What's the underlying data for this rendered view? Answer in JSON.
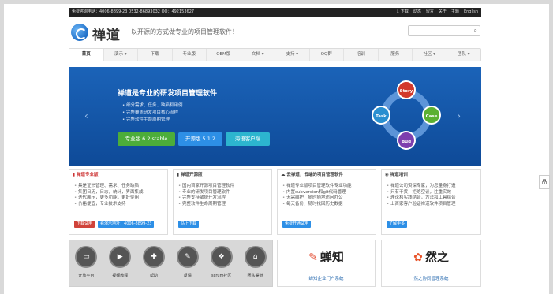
{
  "topbar": {
    "hotline": "免费咨询电话：4006-8899-23 0532-86893032 QQ：492153627",
    "links": [
      "⇩ 下载",
      "动态",
      "留言",
      "关于",
      "主题",
      "English"
    ]
  },
  "header": {
    "logo": "禅道",
    "slogan": "以开源的方式做专业的项目管理软件！",
    "search_icon": "⌕"
  },
  "nav": [
    "首页",
    "演示 ▾",
    "下载",
    "专业版",
    "OEM版",
    "文档 ▾",
    "支持 ▾",
    "QQ群",
    "培训",
    "服务",
    "社区 ▾",
    "团队 ▾"
  ],
  "banner": {
    "title": "禅道是专业的研发项目管理软件",
    "features": [
      "细分需求、任务、缺陷和用例",
      "完整覆盖研发项目核心流程",
      "完整软件生命周期管理"
    ],
    "btn_pro": "专业版 6.2.stable",
    "btn_open": "开源版 5.1.2",
    "btn_client": "海语客户端",
    "wheel": [
      "Story",
      "Case",
      "Bug",
      "Task"
    ],
    "prev": "‹",
    "next": "›"
  },
  "panels": [
    {
      "title": "▮ 禅道专业版",
      "items": [
        "集是证书管理、需求、任务缺陷",
        "集团日历，日志，统计，界面集成",
        "迭代展示，更多功能，更好使用",
        "价格便宜，专业技术支持"
      ],
      "tags": [
        "下载试用",
        "看演示地址：4006-8899-23"
      ]
    },
    {
      "title": "▮ 禅道开源版",
      "items": [
        "国内首家开源项目管理软件",
        "专业的研发项目管理软件",
        "完整支持敏捷开发流程",
        "完整软件生命周期管理"
      ],
      "tags": [
        "马上下载"
      ]
    },
    {
      "title": "☁ 云禅道，云端的项目管理软件",
      "items": [
        "禅道专业版项目管理软件专业功能",
        "内置subversion和git代码管理",
        "无需维护，随时随地访问办公",
        "每天备份，随时找回历史数据"
      ],
      "tags": [
        "免费开通试用"
      ]
    },
    {
      "title": "◉ 禅道培训",
      "items": [
        "禅道公司资深专家，为您量身打造",
        "只有干货，拒绝空谈，注重实效",
        "理论和实践结合，方法和工具结合",
        "上百家客户验证禅道软件项目管理"
      ],
      "tags": [
        "了解更多"
      ]
    }
  ],
  "tools": [
    {
      "icon": "▭",
      "label": "开放平台"
    },
    {
      "icon": "▶",
      "label": "视频教程"
    },
    {
      "icon": "✚",
      "label": "帮助"
    },
    {
      "icon": "✎",
      "label": "反馈"
    },
    {
      "icon": "❖",
      "label": "scrum社区"
    },
    {
      "icon": "⌂",
      "label": "团队渠道"
    }
  ],
  "products": [
    {
      "mark": "✎",
      "name": "蝉知",
      "caption": "蝉知企业门户系统"
    },
    {
      "mark": "✿",
      "name": "然之",
      "caption": "然之协同管理系统"
    }
  ],
  "side": "品"
}
